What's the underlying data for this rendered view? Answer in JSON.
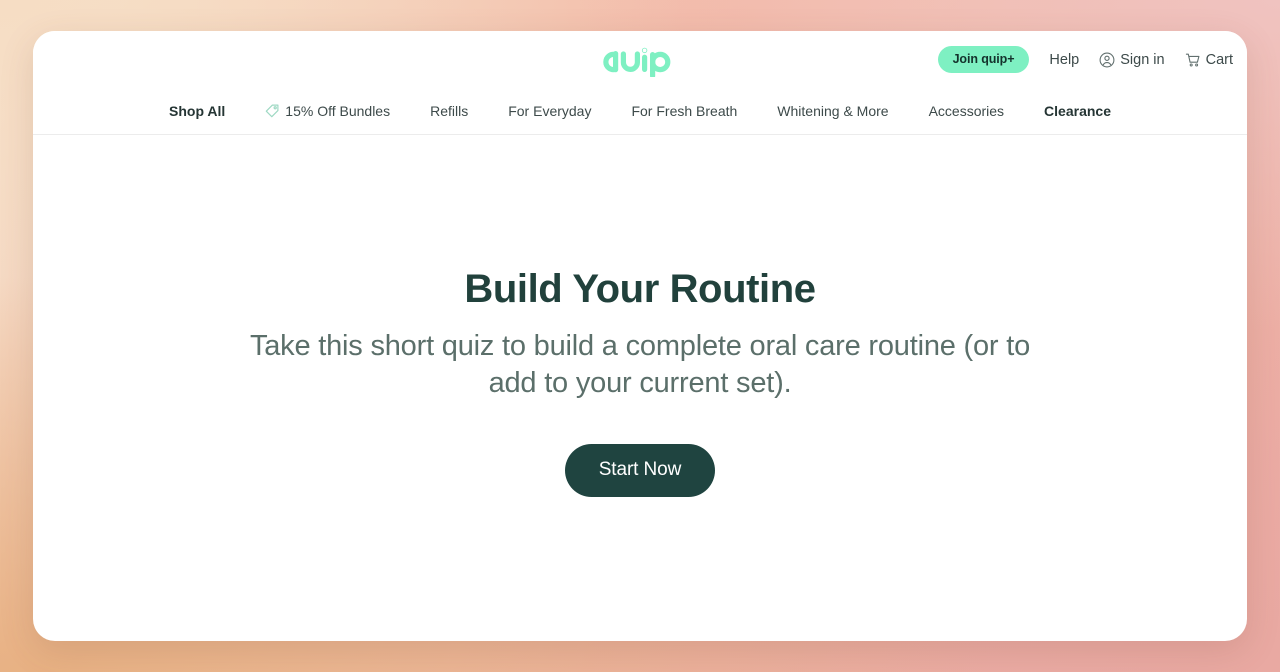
{
  "brand": {
    "logo_text": "quip",
    "logo_color": "#7ef0c2",
    "accent_mint": "#7ef0c2",
    "dark_teal": "#1f4440"
  },
  "header": {
    "join_label": "Join quip+",
    "help_label": "Help",
    "signin_label": "Sign in",
    "signin_icon": "user-circle-icon",
    "cart_label": "Cart",
    "cart_icon": "shopping-cart-icon"
  },
  "nav": {
    "items": [
      {
        "label": "Shop All",
        "bold": true,
        "icon": null
      },
      {
        "label": "15% Off Bundles",
        "bold": false,
        "icon": "price-tag-icon"
      },
      {
        "label": "Refills",
        "bold": false,
        "icon": null
      },
      {
        "label": "For Everyday",
        "bold": false,
        "icon": null
      },
      {
        "label": "For Fresh Breath",
        "bold": false,
        "icon": null
      },
      {
        "label": "Whitening & More",
        "bold": false,
        "icon": null
      },
      {
        "label": "Accessories",
        "bold": false,
        "icon": null
      },
      {
        "label": "Clearance",
        "bold": true,
        "icon": null
      }
    ]
  },
  "hero": {
    "title": "Build Your Routine",
    "subtitle": "Take this short quiz to build a complete oral care routine (or to add to your current set).",
    "cta_label": "Start Now"
  }
}
